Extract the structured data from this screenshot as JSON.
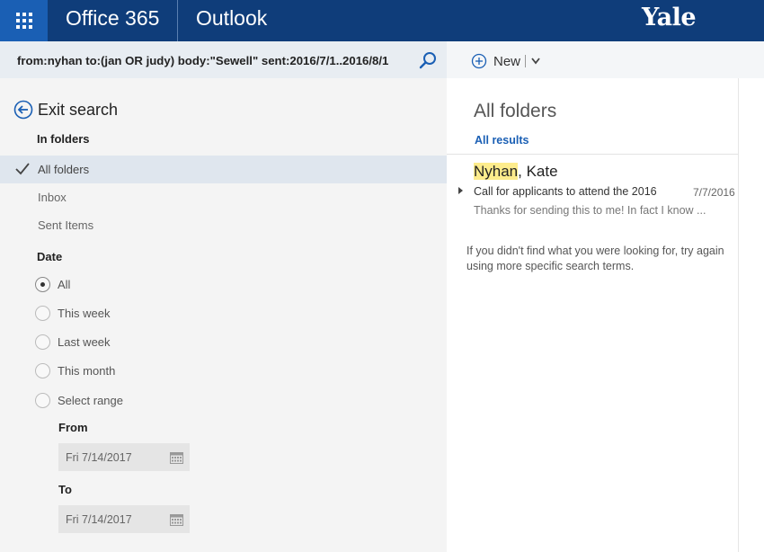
{
  "header": {
    "brand": "Office 365",
    "app": "Outlook",
    "org_logo": "Yale"
  },
  "search": {
    "query": "from:nyhan to:(jan OR judy) body:\"Sewell\" sent:2016/7/1..2016/8/1"
  },
  "commands": {
    "new_label": "New"
  },
  "left": {
    "exit_label": "Exit search",
    "in_folders_heading": "In folders",
    "folders": [
      {
        "label": "All folders",
        "selected": true
      },
      {
        "label": "Inbox",
        "selected": false
      },
      {
        "label": "Sent Items",
        "selected": false
      }
    ],
    "date_heading": "Date",
    "date_options": [
      {
        "label": "All",
        "selected": true
      },
      {
        "label": "This week",
        "selected": false
      },
      {
        "label": "Last week",
        "selected": false
      },
      {
        "label": "This month",
        "selected": false
      },
      {
        "label": "Select range",
        "selected": false
      }
    ],
    "from_label": "From",
    "from_value": "Fri 7/14/2017",
    "to_label": "To",
    "to_value": "Fri 7/14/2017"
  },
  "results": {
    "title": "All folders",
    "filter_label": "All results",
    "messages": [
      {
        "sender_highlight": "Nyhan",
        "sender_rest": ", Kate",
        "subject": "Call for applicants to attend the 2016",
        "date": "7/7/2016",
        "preview": "Thanks for sending this to me! In fact I know ..."
      }
    ],
    "hint": "If you didn't find what you were looking for, try again using more specific search terms."
  },
  "colors": {
    "topbar": "#0f3d7a",
    "waffle": "#1a5fb4",
    "accent": "#1a5fb4",
    "highlight": "#fdec8c"
  }
}
